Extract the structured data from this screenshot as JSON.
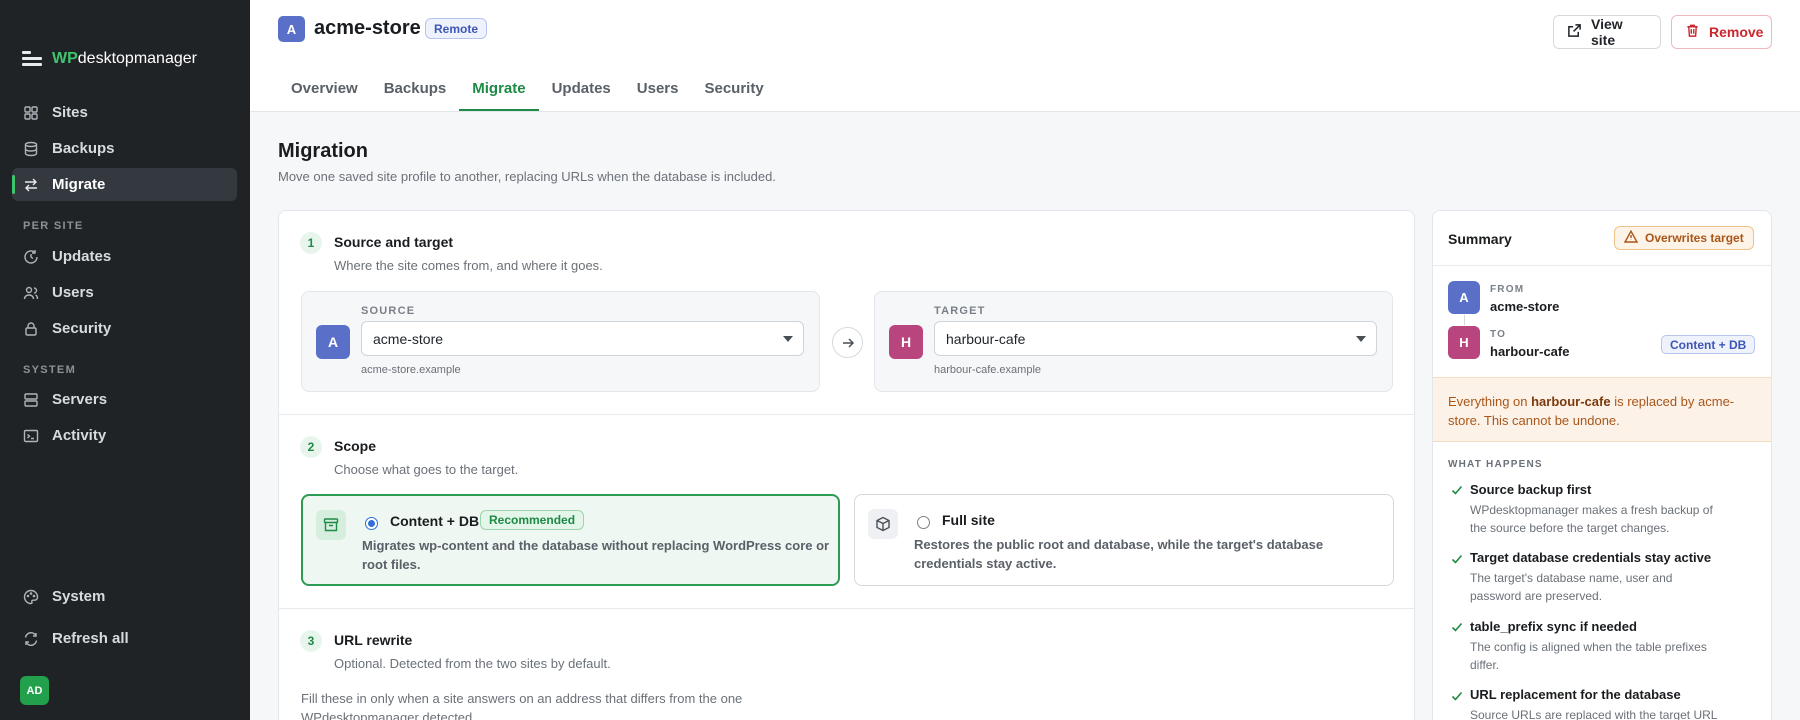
{
  "sidebar": {
    "brand_prefix": "WP",
    "brand_rest": "desktopmanager",
    "items": [
      {
        "label": "Sites",
        "icon": "grid-icon"
      },
      {
        "label": "Backups",
        "icon": "database-icon"
      },
      {
        "label": "Migrate",
        "icon": "swap-arrows-icon",
        "active": true
      }
    ],
    "per_site_heading": "PER SITE",
    "per_site_items": [
      {
        "label": "Updates",
        "icon": "refresh-clock-icon"
      },
      {
        "label": "Users",
        "icon": "users-icon"
      },
      {
        "label": "Security",
        "icon": "lock-icon"
      }
    ],
    "system_heading": "SYSTEM",
    "system_items": [
      {
        "label": "Servers",
        "icon": "server-icon"
      },
      {
        "label": "Activity",
        "icon": "terminal-icon"
      }
    ],
    "bottom_items": [
      {
        "label": "System",
        "icon": "palette-icon"
      },
      {
        "label": "Refresh all",
        "icon": "refresh-icon"
      }
    ],
    "avatar_initials": "AD"
  },
  "header": {
    "site_initial": "A",
    "site_name": "acme-store",
    "site_badge": "Remote",
    "view_site": "View site",
    "remove": "Remove",
    "tabs": [
      "Overview",
      "Backups",
      "Migrate",
      "Updates",
      "Users",
      "Security"
    ],
    "active_tab": "Migrate"
  },
  "page": {
    "title": "Migration",
    "subtitle": "Move one saved site profile to another, replacing URLs when the database is included."
  },
  "steps": {
    "s1": {
      "num": "1",
      "title": "Source and target",
      "subtitle": "Where the site comes from, and where it goes."
    },
    "source": {
      "label": "SOURCE",
      "initial": "A",
      "value": "acme-store",
      "host": "acme-store.example"
    },
    "target": {
      "label": "TARGET",
      "initial": "H",
      "value": "harbour-cafe",
      "host": "harbour-cafe.example"
    },
    "s2": {
      "num": "2",
      "title": "Scope",
      "subtitle": "Choose what goes to the target."
    },
    "opt1": {
      "title": "Content + DB",
      "badge": "Recommended",
      "desc1": "Migrates wp-content and the database without replacing WordPress core or",
      "desc2": "root files.",
      "selected": true
    },
    "opt2": {
      "title": "Full site",
      "desc1": "Restores the public root and database, while the target's database",
      "desc2": "credentials stay active.",
      "selected": false
    },
    "s3": {
      "num": "3",
      "title": "URL rewrite",
      "subtitle": "Optional. Detected from the two sites by default."
    },
    "s3_note1": "Fill these in only when a site answers on an address that differs from the one",
    "s3_note2": "WPdesktopmanager detected."
  },
  "summary": {
    "title": "Summary",
    "warning": "Overwrites target",
    "from_label": "FROM",
    "from_initial": "A",
    "from_value": "acme-store",
    "to_label": "TO",
    "to_initial": "H",
    "to_value": "harbour-cafe",
    "scope_pill": "Content + DB",
    "alert_pre": "Everything on ",
    "alert_bold": "harbour-cafe",
    "alert_post1": " is replaced by acme-",
    "alert_post2": "store. This cannot be undone.",
    "what_happens": "WHAT HAPPENS",
    "items": [
      {
        "title": "Source backup first",
        "desc1": "WPdesktopmanager makes a fresh backup of",
        "desc2": "the source before the target changes."
      },
      {
        "title": "Target database credentials stay active",
        "desc1": "The target's database name, user and",
        "desc2": "password are preserved."
      },
      {
        "title": "table_prefix sync if needed",
        "desc1": "The config is aligned when the table prefixes",
        "desc2": "differ."
      },
      {
        "title": "URL replacement for the database",
        "desc1": "Source URLs are replaced with the target URL",
        "desc2": ""
      }
    ]
  },
  "colors": {
    "accent": "#1e8a45",
    "sidebar_bg": "#1f2326",
    "source_avatar": "#5a6fc7",
    "target_avatar": "#b9457e",
    "danger": "#c9282e",
    "warning": "#a9561a"
  }
}
